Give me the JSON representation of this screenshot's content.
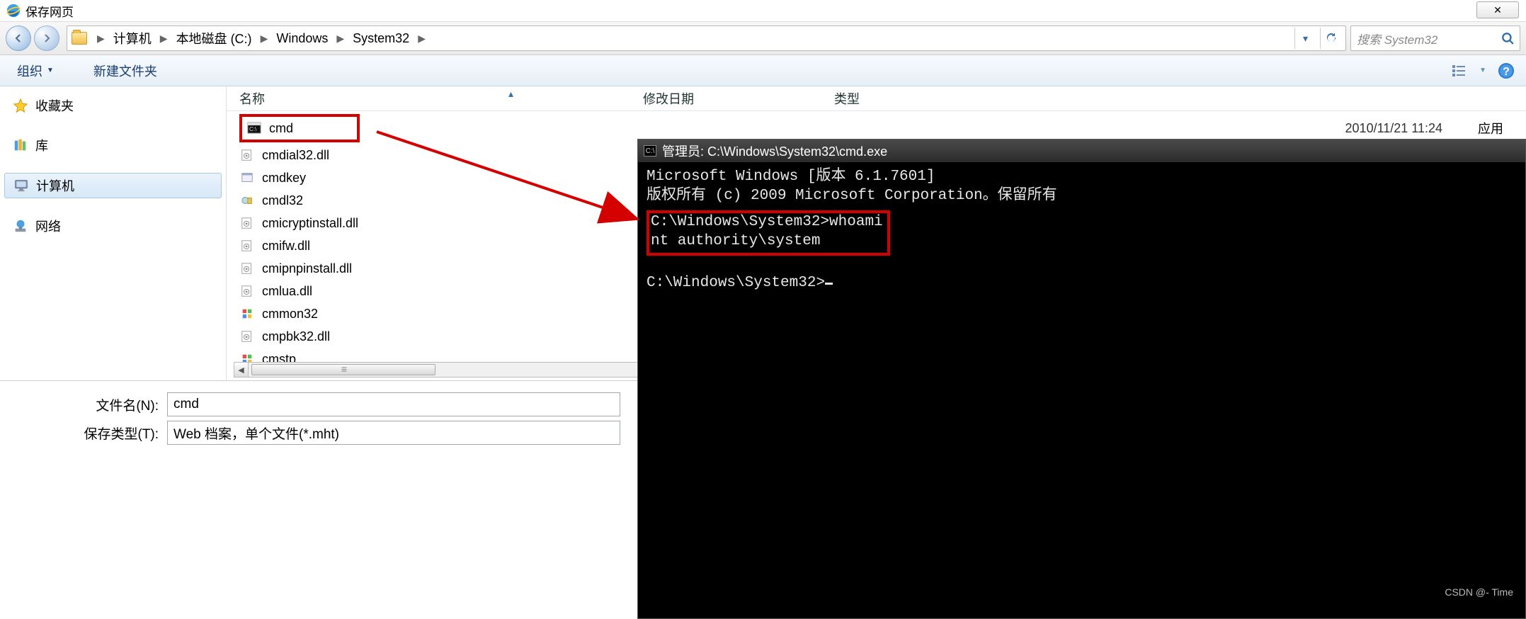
{
  "window": {
    "title": "保存网页",
    "close_glyph": "✕"
  },
  "nav": {
    "breadcrumb": [
      "计算机",
      "本地磁盘 (C:)",
      "Windows",
      "System32"
    ],
    "search_placeholder": "搜索 System32"
  },
  "toolbar": {
    "organize": "组织",
    "new_folder": "新建文件夹"
  },
  "sidebar": {
    "favorites": "收藏夹",
    "libraries": "库",
    "computer": "计算机",
    "network": "网络"
  },
  "columns": {
    "name": "名称",
    "date": "修改日期",
    "type": "类型"
  },
  "files": [
    {
      "name": "cmd",
      "date": "2010/11/21 11:24",
      "type": "应用"
    },
    {
      "name": "cmdial32.dll"
    },
    {
      "name": "cmdkey"
    },
    {
      "name": "cmdl32"
    },
    {
      "name": "cmicryptinstall.dll"
    },
    {
      "name": "cmifw.dll"
    },
    {
      "name": "cmipnpinstall.dll"
    },
    {
      "name": "cmlua.dll"
    },
    {
      "name": "cmmon32"
    },
    {
      "name": "cmpbk32.dll"
    },
    {
      "name": "cmstp"
    }
  ],
  "form": {
    "filename_label": "文件名(N):",
    "filename_value": "cmd",
    "savetype_label": "保存类型(T):",
    "savetype_value": "Web 档案，单个文件(*.mht)"
  },
  "cmd": {
    "title": "管理员: C:\\Windows\\System32\\cmd.exe",
    "line1": "Microsoft Windows [版本 6.1.7601]",
    "line2": "版权所有 (c) 2009 Microsoft Corporation。保留所有",
    "prompt1": "C:\\Windows\\System32>whoami",
    "out1": "nt authority\\system",
    "prompt2": "C:\\Windows\\System32>"
  },
  "watermark": "CSDN @- Time"
}
